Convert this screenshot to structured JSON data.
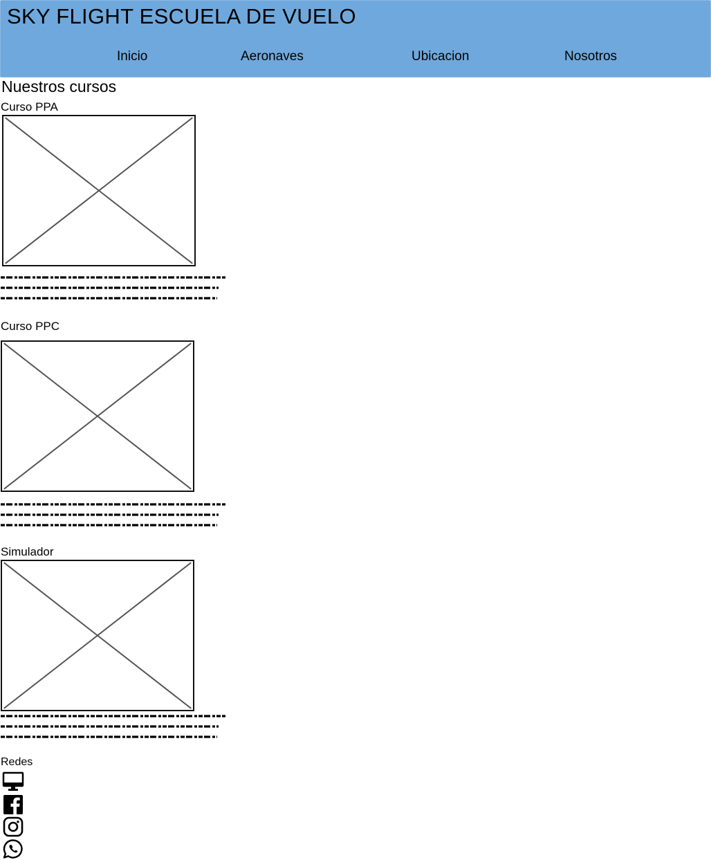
{
  "header": {
    "title": "SKY FLIGHT ESCUELA DE VUELO",
    "nav": [
      "Inicio",
      "Aeronaves",
      "Ubicacion",
      "Nosotros"
    ]
  },
  "main": {
    "section_title": "Nuestros cursos",
    "courses": [
      {
        "title": "Curso PPA"
      },
      {
        "title": "Curso PPC"
      },
      {
        "title": "Simulador"
      }
    ]
  },
  "footer": {
    "label": "Redes",
    "icons": [
      "monitor-icon",
      "facebook-icon",
      "instagram-icon",
      "whatsapp-icon"
    ]
  },
  "colors": {
    "header_bg": "#6fa8dc",
    "placeholder_cross": "#555555",
    "text": "#000000"
  }
}
